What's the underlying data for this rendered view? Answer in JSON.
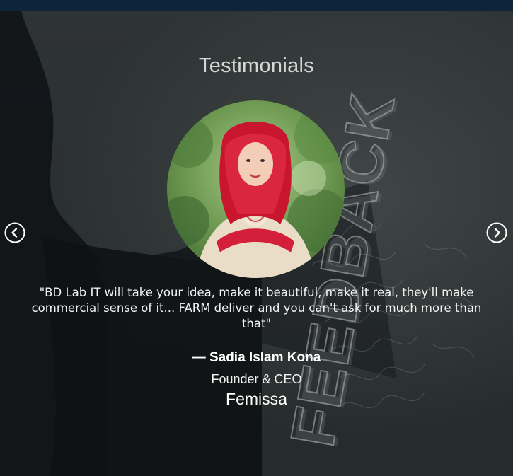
{
  "section": {
    "title": "Testimonials",
    "background_word": "FEEDBACK"
  },
  "testimonial": {
    "quote": "\"BD Lab IT will take your idea, make it beautiful, make it real, they'll make commercial sense of it... FARM deliver and you can't ask for much more than that\"",
    "author": "— Sadia Islam Kona",
    "role": "Founder & CEO",
    "company": "Femissa"
  },
  "icons": {
    "prev": "chevron-left-circle-icon",
    "next": "chevron-right-circle-icon"
  },
  "colors": {
    "top_bar": "#0e2438",
    "background": "#2c3030",
    "text": "#ffffff",
    "title": "#d6d6d6"
  }
}
